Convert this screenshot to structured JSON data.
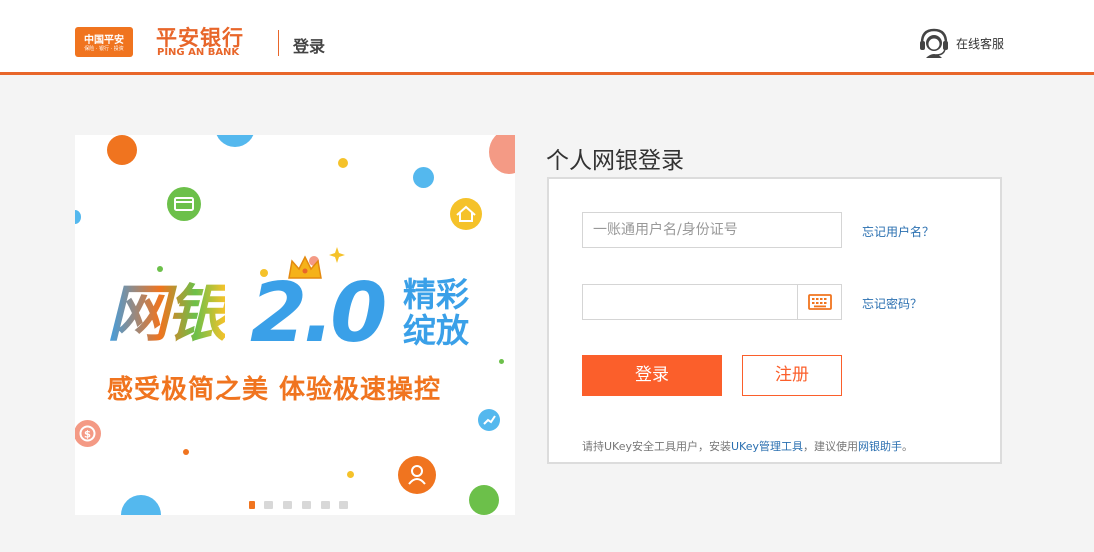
{
  "header": {
    "logo_ping_cn": "中国平安",
    "logo_ping_sub": "保险 · 银行 · 投资",
    "bank_cn": "平安银行",
    "bank_en": "PING AN BANK",
    "page_title": "登录",
    "support_label": "在线客服",
    "accent_color": "#e8662a"
  },
  "banner": {
    "headline_part1": "网银",
    "headline_part2": "2.0",
    "headline_side": "精彩绽放",
    "slogan": "感受极简之美  体验极速操控",
    "slide_count": 6,
    "active_slide": 1
  },
  "login": {
    "title": "个人网银登录",
    "username_placeholder": "一账通用户名/身份证号",
    "username_value": "",
    "password_value": "",
    "forgot_username": "忘记用户名？",
    "forgot_password": "忘记密码？",
    "login_button": "登录",
    "register_button": "注册",
    "tip_prefix": "请持UKey安全工具用户，安装",
    "tip_link1": "UKey管理工具",
    "tip_middle": "，建议使用",
    "tip_link2": "网银助手",
    "tip_suffix": "。",
    "primary_color": "#fb5f2b"
  }
}
